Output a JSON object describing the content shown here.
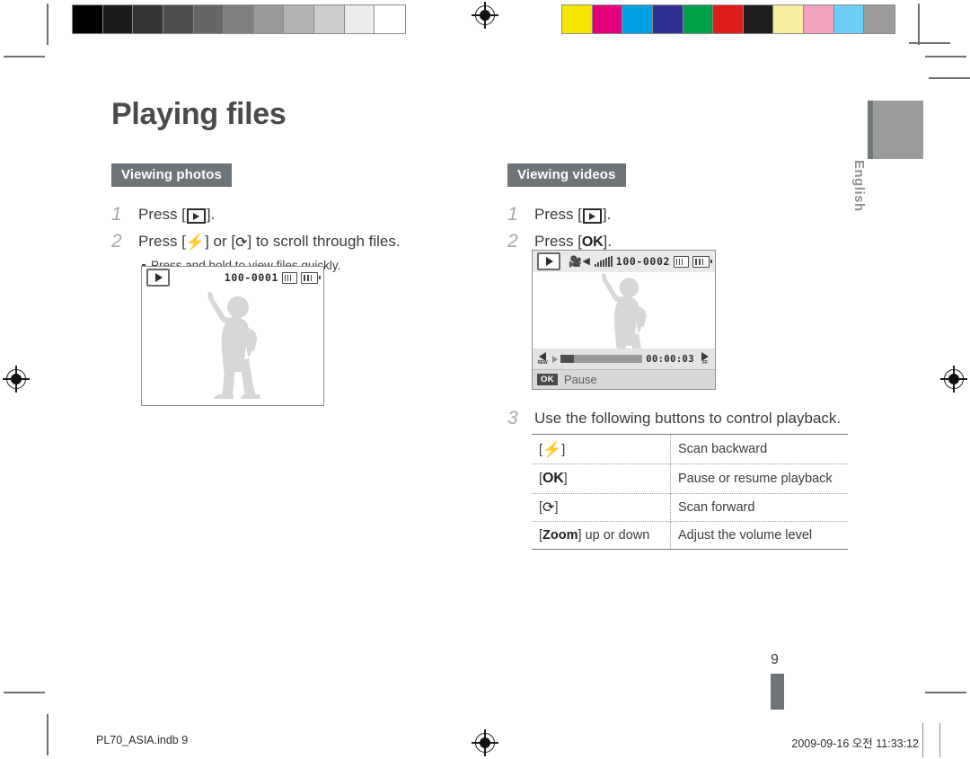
{
  "page": {
    "title": "Playing files",
    "number": "9",
    "language_tab": "English"
  },
  "calibration": {
    "grayscale_label": "grayscale-step-wedge",
    "grayscale_patches": [
      "#000000",
      "#1c1c1c",
      "#343434",
      "#4d4d4d",
      "#666666",
      "#7f7f7f",
      "#999999",
      "#b2b2b2",
      "#cccccc",
      "#ececec",
      "#ffffff"
    ],
    "color_label": "color-control-patches",
    "color_patches": [
      "#f5e500",
      "#e3007f",
      "#00a0e4",
      "#2e3192",
      "#00a04a",
      "#e01b1b",
      "#211e1e",
      "#f8eea0",
      "#f2a2bf",
      "#6ecff6",
      "#9a9a9a"
    ]
  },
  "sections": [
    {
      "id": "viewing-photos",
      "badge": "Viewing photos",
      "steps": [
        {
          "num": "1",
          "prefix": "Press [",
          "keys": [
            "play-icon"
          ],
          "suffix": "]."
        },
        {
          "num": "2",
          "prefix": "Press [",
          "keys": [
            "flash-icon",
            "timer-icon"
          ],
          "middle": "] or [",
          "suffix": "] to scroll through files.",
          "note": "Press and hold to view files quickly."
        }
      ]
    },
    {
      "id": "viewing-videos",
      "badge": "Viewing videos",
      "steps": [
        {
          "num": "1",
          "prefix": "Press [",
          "keys": [
            "play-icon"
          ],
          "suffix": "]."
        },
        {
          "num": "2",
          "prefix": "Press [",
          "keys": [
            "ok-key"
          ],
          "key_label": "OK",
          "suffix": "]."
        },
        {
          "num": "3",
          "text": "Use the following buttons to control playback."
        }
      ]
    }
  ],
  "lcd_photo": {
    "name": "photo-playback-screen",
    "play_icon": "play-icon",
    "file_number": "100-0001",
    "memory_icon": "memory-card-icon",
    "battery_icon": "battery-icon",
    "subject": "person-silhouette"
  },
  "lcd_video": {
    "name": "video-playback-screen",
    "play_icon": "play-icon",
    "movie_icon": "camcorder-icon",
    "speaker_icon": "speaker-icon",
    "volume_bars": 7,
    "file_number": "100-0002",
    "memory_icon": "memory-card-icon",
    "battery_icon": "battery-icon",
    "subject": "person-silhouette",
    "rew_label": "REW",
    "ff_label": "FF",
    "timecode": "00:00:03",
    "progress_percent": 16,
    "ok_chip": "OK",
    "status_label": "Pause"
  },
  "control_table": {
    "name": "playback-control-table",
    "rows": [
      {
        "key_prefix": "[",
        "key_icon": "flash-icon",
        "key_suffix": "]",
        "description": "Scan backward"
      },
      {
        "key_prefix": "[",
        "key_text": "OK",
        "key_suffix": "]",
        "description": "Pause or resume playback"
      },
      {
        "key_prefix": "[",
        "key_icon": "timer-icon",
        "key_suffix": "]",
        "description": "Scan forward"
      },
      {
        "key_prefix": "[",
        "key_text": "Zoom",
        "key_suffix": "] up or down",
        "description": "Adjust the volume level"
      }
    ]
  },
  "footer": {
    "left": "PL70_ASIA.indb   9",
    "right": "2009-09-16   오전 11:33:12"
  },
  "colors": {
    "badge_gray": "#6e7477",
    "title_gray": "#4a4a4a",
    "tab_gray": "#9a9a9a"
  }
}
